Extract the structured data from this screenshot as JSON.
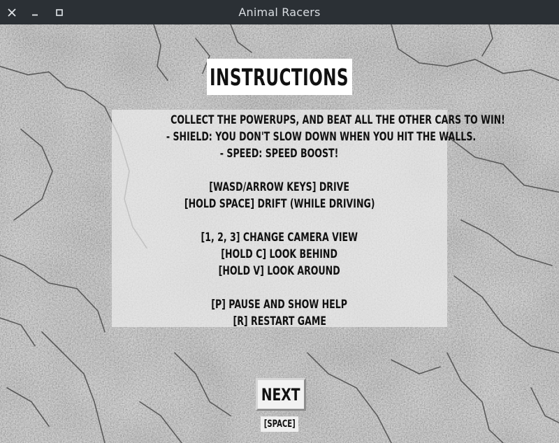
{
  "window": {
    "title": "Animal Racers",
    "controls": [
      "close",
      "minimize",
      "maximize"
    ]
  },
  "screen": {
    "heading": "INSTRUCTIONS",
    "lines": [
      "COLLECT THE POWERUPS, AND BEAT ALL THE OTHER CARS TO WIN!",
      "- SHIELD: YOU DON'T SLOW DOWN WHEN YOU HIT THE WALLS.",
      "- SPEED: SPEED BOOST!",
      "",
      "[WASD/ARROW KEYS] DRIVE",
      "[HOLD SPACE] DRIFT (WHILE DRIVING)",
      "",
      "[1, 2, 3] CHANGE CAMERA VIEW",
      "[HOLD C] LOOK BEHIND",
      "[HOLD V] LOOK AROUND",
      "",
      "[P] PAUSE AND SHOW HELP",
      "[R] RESTART GAME"
    ],
    "next_label": "NEXT",
    "next_hint": "[SPACE]"
  },
  "colors": {
    "titlebar": "#2b3035",
    "background_stone": "#9a9a9a",
    "panel": "#ebebeb",
    "text": "#111111"
  }
}
